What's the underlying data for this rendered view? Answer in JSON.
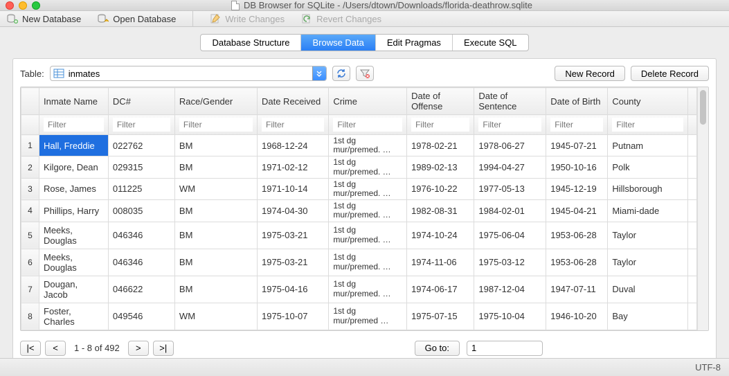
{
  "title": "DB Browser for SQLite - /Users/dtown/Downloads/florida-deathrow.sqlite",
  "toolbar": {
    "new_db": "New Database",
    "open_db": "Open Database",
    "write": "Write Changes",
    "revert": "Revert Changes"
  },
  "tabs": {
    "structure": "Database Structure",
    "browse": "Browse Data",
    "pragmas": "Edit Pragmas",
    "sql": "Execute SQL"
  },
  "controls": {
    "table_label": "Table:",
    "table_value": "inmates",
    "new_record": "New Record",
    "delete_record": "Delete Record"
  },
  "columns": [
    "Inmate Name",
    "DC#",
    "Race/Gender",
    "Date Received",
    "Crime",
    "Date of Offense",
    "Date of Sentence",
    "Date of Birth",
    "County"
  ],
  "filter_placeholder": "Filter",
  "rows": [
    {
      "n": "1",
      "cells": [
        "Hall, Freddie",
        "022762",
        "BM",
        "1968-12-24",
        "1st dg mur/premed. …",
        "1978-02-21",
        "1978-06-27",
        "1945-07-21",
        "Putnam"
      ],
      "selected_col": 0
    },
    {
      "n": "2",
      "cells": [
        "Kilgore, Dean",
        "029315",
        "BM",
        "1971-02-12",
        "1st dg mur/premed. …",
        "1989-02-13",
        "1994-04-27",
        "1950-10-16",
        "Polk"
      ]
    },
    {
      "n": "3",
      "cells": [
        "Rose, James",
        "011225",
        "WM",
        "1971-10-14",
        "1st dg mur/premed. …",
        "1976-10-22",
        "1977-05-13",
        "1945-12-19",
        "Hillsborough"
      ]
    },
    {
      "n": "4",
      "cells": [
        "Phillips, Harry",
        "008035",
        "BM",
        "1974-04-30",
        "1st dg mur/premed. …",
        "1982-08-31",
        "1984-02-01",
        "1945-04-21",
        "Miami-dade"
      ]
    },
    {
      "n": "5",
      "cells": [
        "Meeks, Douglas",
        "046346",
        "BM",
        "1975-03-21",
        "1st dg mur/premed. …",
        "1974-10-24",
        "1975-06-04",
        "1953-06-28",
        "Taylor"
      ]
    },
    {
      "n": "6",
      "cells": [
        "Meeks, Douglas",
        "046346",
        "BM",
        "1975-03-21",
        "1st dg mur/premed. …",
        "1974-11-06",
        "1975-03-12",
        "1953-06-28",
        "Taylor"
      ]
    },
    {
      "n": "7",
      "cells": [
        "Dougan, Jacob",
        "046622",
        "BM",
        "1975-04-16",
        "1st dg mur/premed. …",
        "1974-06-17",
        "1987-12-04",
        "1947-07-11",
        "Duval"
      ]
    },
    {
      "n": "8",
      "cells": [
        "Foster, Charles",
        "049546",
        "WM",
        "1975-10-07",
        "1st dg mur/premed …",
        "1975-07-15",
        "1975-10-04",
        "1946-10-20",
        "Bay"
      ]
    }
  ],
  "pager": {
    "first": "|<",
    "prev": "<",
    "label": "1 - 8 of 492",
    "next": ">",
    "last": ">|",
    "goto_label": "Go to:",
    "goto_value": "1"
  },
  "status": {
    "encoding": "UTF-8"
  }
}
